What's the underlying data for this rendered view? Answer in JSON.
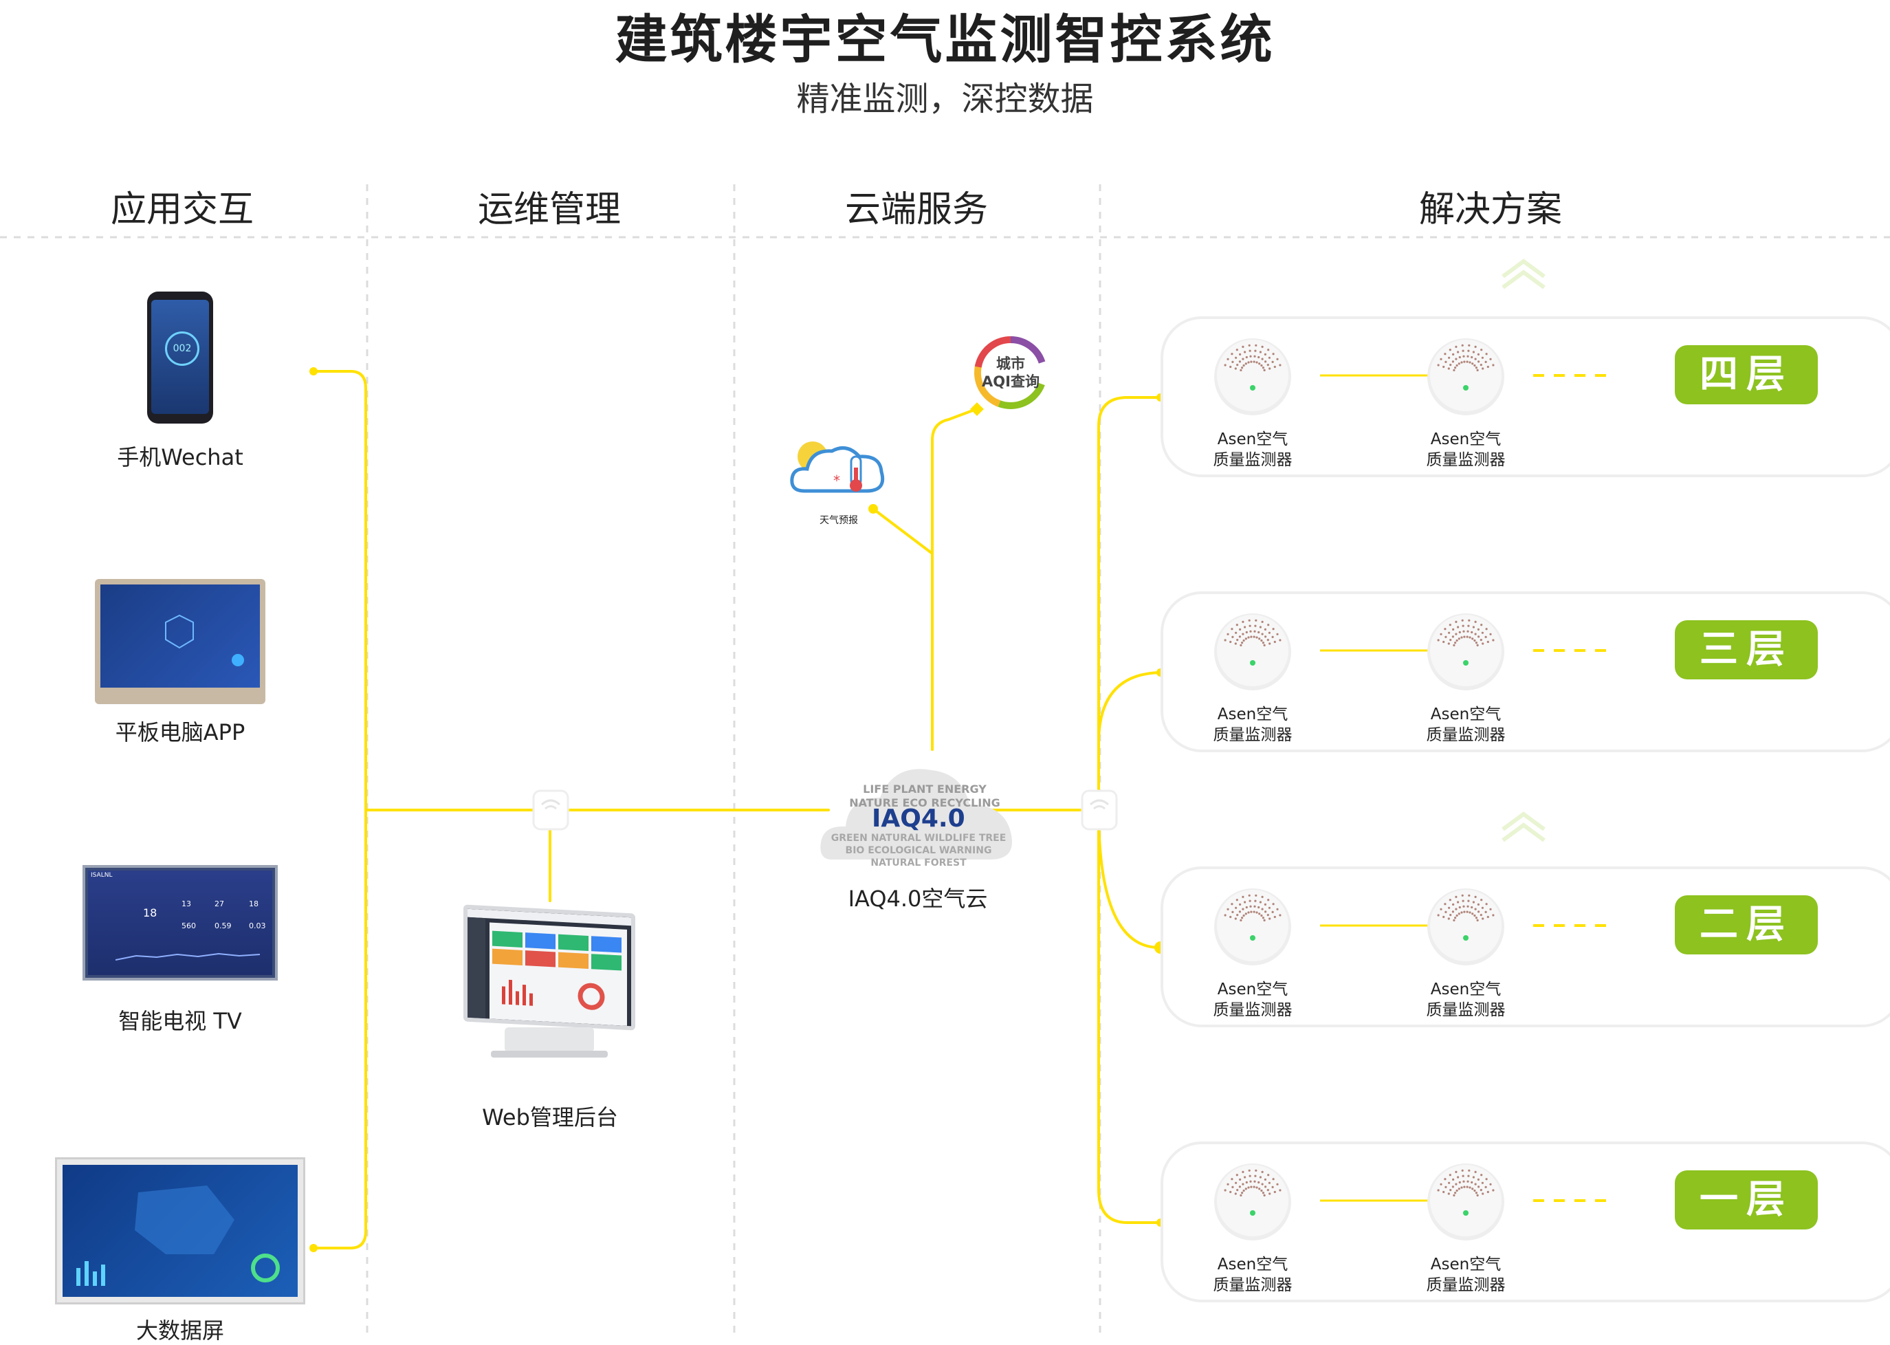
{
  "header": {
    "title": "建筑楼宇空气监测智控系统",
    "subtitle": "精准监测，深控数据"
  },
  "columns": [
    {
      "label": "应用交互"
    },
    {
      "label": "运维管理"
    },
    {
      "label": "云端服务"
    },
    {
      "label": "解决方案"
    }
  ],
  "devices": {
    "phone": "手机Wechat",
    "tablet": "平板电脑APP",
    "tv": "智能电视 TV",
    "bigscreen": "大数据屏"
  },
  "phone_screen": {
    "value": "002"
  },
  "tv_screen": {
    "logo": "ISALNL",
    "v1": "18",
    "v2": "13",
    "v3": "27",
    "v4": "18",
    "v5": "560",
    "v6": "0.59",
    "v7": "0.03"
  },
  "web": {
    "label": "Web管理后台"
  },
  "cloud": {
    "label": "IAQ4.0空气云",
    "logo": "IAQ4.0",
    "words": [
      "LIFE",
      "PLANT",
      "ENERGY",
      "NATURE",
      "ECO",
      "RECYCLING",
      "GREEN",
      "NATURAL",
      "WILDLIFE",
      "TREE",
      "BIO",
      "ECOLOGICAL WARNING NATURAL",
      "FOREST"
    ]
  },
  "weather": {
    "label": "天气预报"
  },
  "aqi": {
    "line1": "城市",
    "line2": "AQI查询"
  },
  "floors": [
    {
      "badge": "四层",
      "sensors": [
        {
          "line1": "Asen空气",
          "line2": "质量监测器"
        },
        {
          "line1": "Asen空气",
          "line2": "质量监测器"
        }
      ]
    },
    {
      "badge": "三层",
      "sensors": [
        {
          "line1": "Asen空气",
          "line2": "质量监测器"
        },
        {
          "line1": "Asen空气",
          "line2": "质量监测器"
        }
      ]
    },
    {
      "badge": "二层",
      "sensors": [
        {
          "line1": "Asen空气",
          "line2": "质量监测器"
        },
        {
          "line1": "Asen空气",
          "line2": "质量监测器"
        }
      ]
    },
    {
      "badge": "一层",
      "sensors": [
        {
          "line1": "Asen空气",
          "line2": "质量监测器"
        },
        {
          "line1": "Asen空气",
          "line2": "质量监测器"
        }
      ]
    }
  ],
  "colors": {
    "line": "#ffe100",
    "badge": "#8dc21f",
    "divider": "#dddddd"
  }
}
